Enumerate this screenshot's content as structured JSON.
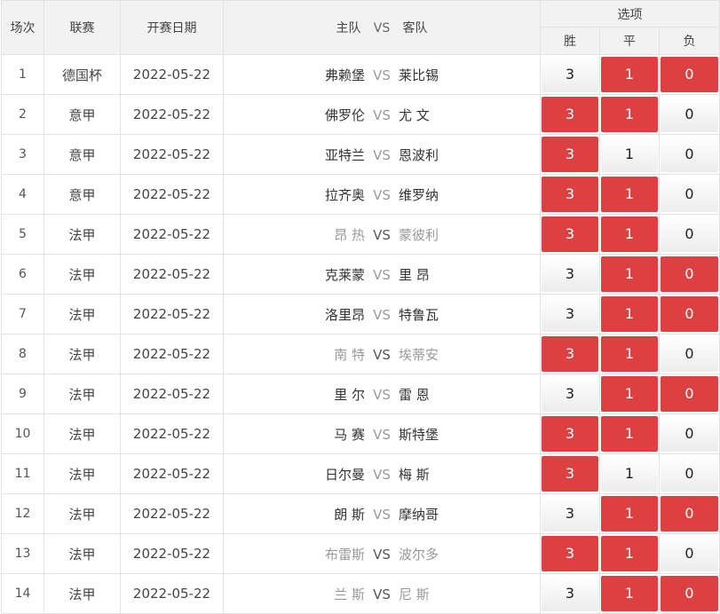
{
  "headers": {
    "index": "场次",
    "league": "联赛",
    "date": "开赛日期",
    "home": "主队",
    "vs": "VS",
    "away": "客队",
    "options": "选项",
    "win": "胜",
    "draw": "平",
    "lose": "负"
  },
  "colors": {
    "selected": "#dc4041",
    "header_bg": "#f2f2f2",
    "border": "#e2e2e2"
  },
  "rows": [
    {
      "index": "1",
      "league": "德国杯",
      "date": "2022-05-22",
      "home": "弗赖堡",
      "vs": "VS",
      "away": "莱比锡",
      "win": "3",
      "draw": "1",
      "lose": "0",
      "win_on": false,
      "draw_on": true,
      "lose_on": true,
      "dim": false
    },
    {
      "index": "2",
      "league": "意甲",
      "date": "2022-05-22",
      "home": "佛罗伦",
      "vs": "VS",
      "away": "尤 文",
      "win": "3",
      "draw": "1",
      "lose": "0",
      "win_on": true,
      "draw_on": true,
      "lose_on": false,
      "dim": false
    },
    {
      "index": "3",
      "league": "意甲",
      "date": "2022-05-22",
      "home": "亚特兰",
      "vs": "VS",
      "away": "恩波利",
      "win": "3",
      "draw": "1",
      "lose": "0",
      "win_on": true,
      "draw_on": false,
      "lose_on": false,
      "dim": false
    },
    {
      "index": "4",
      "league": "意甲",
      "date": "2022-05-22",
      "home": "拉齐奥",
      "vs": "VS",
      "away": "维罗纳",
      "win": "3",
      "draw": "1",
      "lose": "0",
      "win_on": true,
      "draw_on": true,
      "lose_on": false,
      "dim": false
    },
    {
      "index": "5",
      "league": "法甲",
      "date": "2022-05-22",
      "home": "昂 热",
      "vs": "VS",
      "away": "蒙彼利",
      "win": "3",
      "draw": "1",
      "lose": "0",
      "win_on": true,
      "draw_on": true,
      "lose_on": false,
      "dim": true
    },
    {
      "index": "6",
      "league": "法甲",
      "date": "2022-05-22",
      "home": "克莱蒙",
      "vs": "VS",
      "away": "里 昂",
      "win": "3",
      "draw": "1",
      "lose": "0",
      "win_on": false,
      "draw_on": true,
      "lose_on": true,
      "dim": false
    },
    {
      "index": "7",
      "league": "法甲",
      "date": "2022-05-22",
      "home": "洛里昂",
      "vs": "VS",
      "away": "特鲁瓦",
      "win": "3",
      "draw": "1",
      "lose": "0",
      "win_on": false,
      "draw_on": true,
      "lose_on": true,
      "dim": false
    },
    {
      "index": "8",
      "league": "法甲",
      "date": "2022-05-22",
      "home": "南 特",
      "vs": "VS",
      "away": "埃蒂安",
      "win": "3",
      "draw": "1",
      "lose": "0",
      "win_on": true,
      "draw_on": true,
      "lose_on": false,
      "dim": true
    },
    {
      "index": "9",
      "league": "法甲",
      "date": "2022-05-22",
      "home": "里 尔",
      "vs": "VS",
      "away": "雷 恩",
      "win": "3",
      "draw": "1",
      "lose": "0",
      "win_on": false,
      "draw_on": true,
      "lose_on": true,
      "dim": false
    },
    {
      "index": "10",
      "league": "法甲",
      "date": "2022-05-22",
      "home": "马 赛",
      "vs": "VS",
      "away": "斯特堡",
      "win": "3",
      "draw": "1",
      "lose": "0",
      "win_on": true,
      "draw_on": true,
      "lose_on": false,
      "dim": false
    },
    {
      "index": "11",
      "league": "法甲",
      "date": "2022-05-22",
      "home": "日尔曼",
      "vs": "VS",
      "away": "梅 斯",
      "win": "3",
      "draw": "1",
      "lose": "0",
      "win_on": true,
      "draw_on": false,
      "lose_on": false,
      "dim": false
    },
    {
      "index": "12",
      "league": "法甲",
      "date": "2022-05-22",
      "home": "朗 斯",
      "vs": "VS",
      "away": "摩纳哥",
      "win": "3",
      "draw": "1",
      "lose": "0",
      "win_on": false,
      "draw_on": true,
      "lose_on": true,
      "dim": false
    },
    {
      "index": "13",
      "league": "法甲",
      "date": "2022-05-22",
      "home": "布雷斯",
      "vs": "VS",
      "away": "波尔多",
      "win": "3",
      "draw": "1",
      "lose": "0",
      "win_on": true,
      "draw_on": true,
      "lose_on": false,
      "dim": true
    },
    {
      "index": "14",
      "league": "法甲",
      "date": "2022-05-22",
      "home": "兰 斯",
      "vs": "VS",
      "away": "尼 斯",
      "win": "3",
      "draw": "1",
      "lose": "0",
      "win_on": false,
      "draw_on": true,
      "lose_on": true,
      "dim": true
    }
  ]
}
